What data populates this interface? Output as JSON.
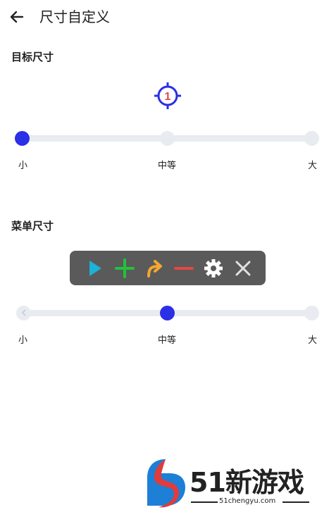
{
  "header": {
    "title": "尺寸自定义",
    "back_icon": "arrow-left-icon"
  },
  "target_size": {
    "title": "目标尺寸",
    "preview_number": "1",
    "preview_color": "#2b2fe6",
    "number_color": "#e04a4a",
    "slider": {
      "labels": [
        "小",
        "中等",
        "大"
      ],
      "selected_index": 0
    }
  },
  "menu_size": {
    "title": "菜单尺寸",
    "menu_buttons": [
      "play-icon",
      "plus-icon",
      "curved-arrow-icon",
      "minus-icon",
      "gear-icon",
      "close-icon"
    ],
    "slider": {
      "labels": [
        "小",
        "中等",
        "大"
      ],
      "selected_index": 1
    }
  },
  "colors": {
    "accent": "#2b2fe6",
    "track": "#e8ebef",
    "menu_bg": "#5a5a5a"
  },
  "watermark": {
    "brand": "51新游戏",
    "url": "51chengyu.com"
  }
}
